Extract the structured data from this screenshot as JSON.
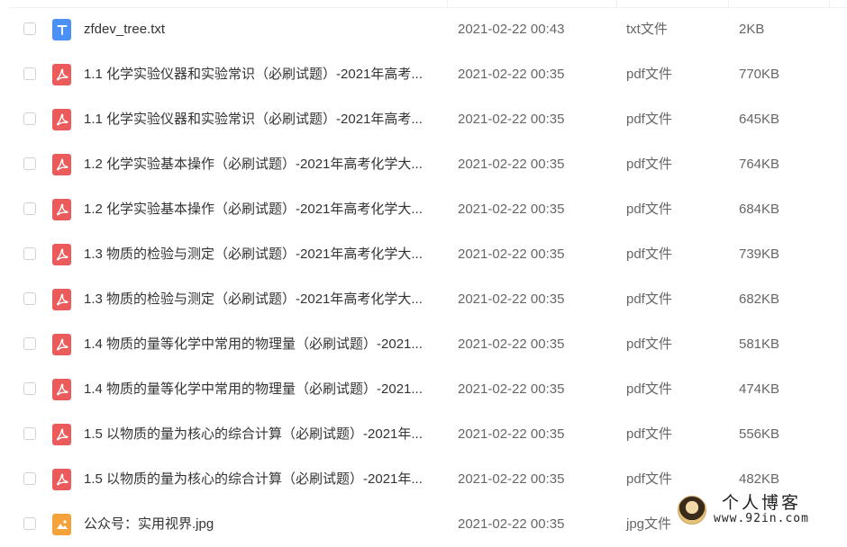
{
  "files": [
    {
      "name": "zfdev_tree.txt",
      "date": "2021-02-22 00:43",
      "type": "txt文件",
      "size": "2KB",
      "icon": "txt-file-icon"
    },
    {
      "name": "1.1 化学实验仪器和实验常识（必刷试题）-2021年高考...",
      "date": "2021-02-22 00:35",
      "type": "pdf文件",
      "size": "770KB",
      "icon": "pdf-file-icon"
    },
    {
      "name": "1.1 化学实验仪器和实验常识（必刷试题）-2021年高考...",
      "date": "2021-02-22 00:35",
      "type": "pdf文件",
      "size": "645KB",
      "icon": "pdf-file-icon"
    },
    {
      "name": "1.2 化学实验基本操作（必刷试题）-2021年高考化学大...",
      "date": "2021-02-22 00:35",
      "type": "pdf文件",
      "size": "764KB",
      "icon": "pdf-file-icon"
    },
    {
      "name": "1.2 化学实验基本操作（必刷试题）-2021年高考化学大...",
      "date": "2021-02-22 00:35",
      "type": "pdf文件",
      "size": "684KB",
      "icon": "pdf-file-icon"
    },
    {
      "name": "1.3 物质的检验与测定（必刷试题）-2021年高考化学大...",
      "date": "2021-02-22 00:35",
      "type": "pdf文件",
      "size": "739KB",
      "icon": "pdf-file-icon"
    },
    {
      "name": "1.3 物质的检验与测定（必刷试题）-2021年高考化学大...",
      "date": "2021-02-22 00:35",
      "type": "pdf文件",
      "size": "682KB",
      "icon": "pdf-file-icon"
    },
    {
      "name": "1.4 物质的量等化学中常用的物理量（必刷试题）-2021...",
      "date": "2021-02-22 00:35",
      "type": "pdf文件",
      "size": "581KB",
      "icon": "pdf-file-icon"
    },
    {
      "name": "1.4 物质的量等化学中常用的物理量（必刷试题）-2021...",
      "date": "2021-02-22 00:35",
      "type": "pdf文件",
      "size": "474KB",
      "icon": "pdf-file-icon"
    },
    {
      "name": "1.5 以物质的量为核心的综合计算（必刷试题）-2021年...",
      "date": "2021-02-22 00:35",
      "type": "pdf文件",
      "size": "556KB",
      "icon": "pdf-file-icon"
    },
    {
      "name": "1.5 以物质的量为核心的综合计算（必刷试题）-2021年...",
      "date": "2021-02-22 00:35",
      "type": "pdf文件",
      "size": "482KB",
      "icon": "pdf-file-icon"
    },
    {
      "name": "公众号：实用视界.jpg",
      "date": "2021-02-22 00:35",
      "type": "jpg文件",
      "size": "",
      "icon": "jpg-file-icon"
    }
  ],
  "watermark": {
    "title": "个人博客",
    "url": "www.92in.com"
  },
  "colors": {
    "pdf": "#ec5b5b",
    "txt": "#4a90f5",
    "jpg": "#f5a23a"
  }
}
